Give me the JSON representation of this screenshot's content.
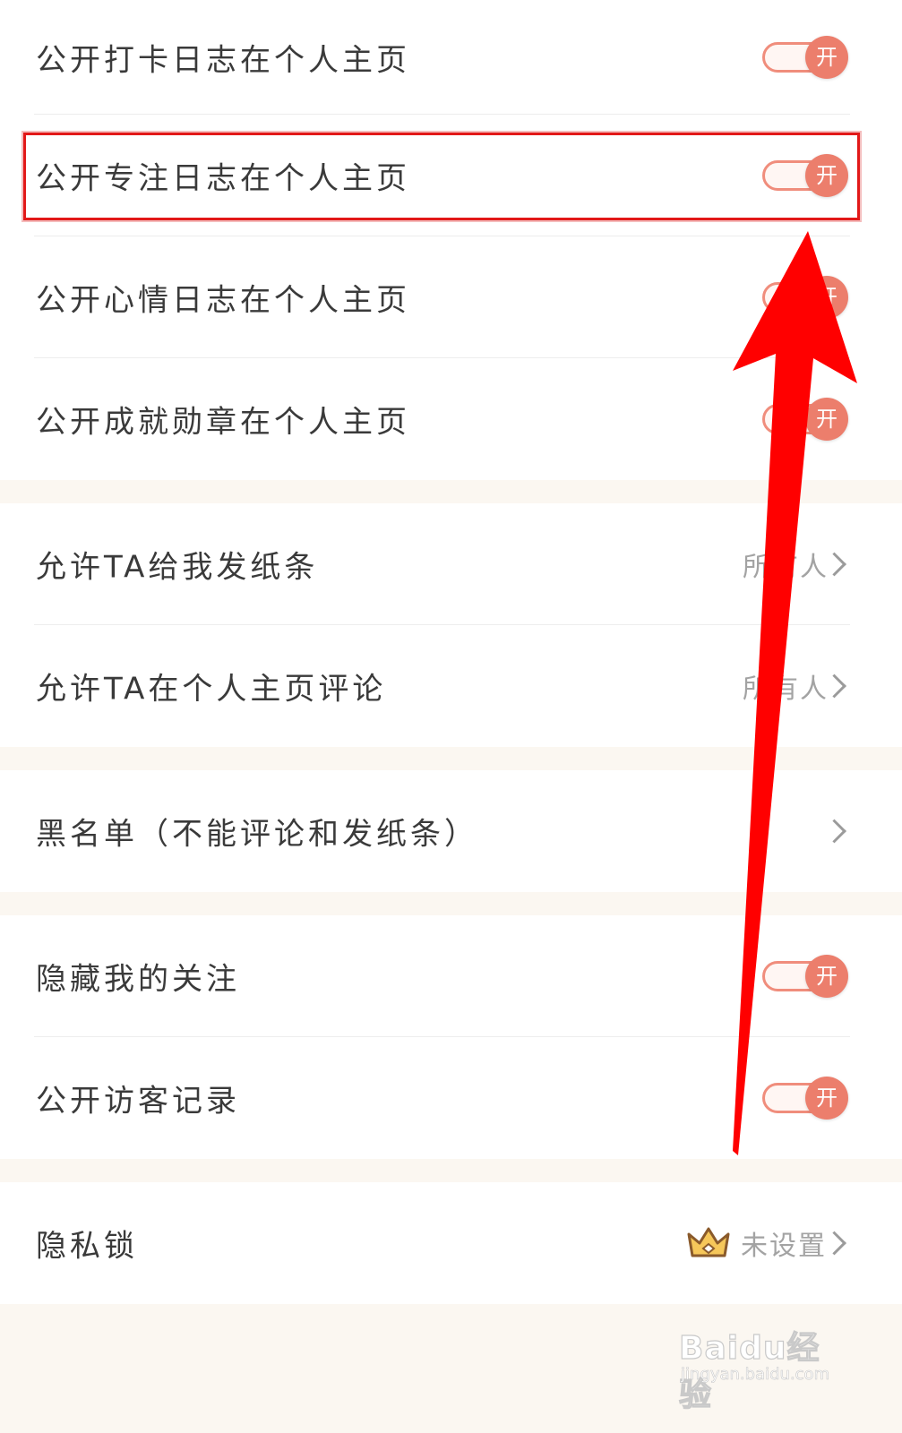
{
  "sections": [
    {
      "rows": [
        {
          "label": "公开打卡日志在个人主页",
          "toggle": "开",
          "on": true
        },
        {
          "label": "公开专注日志在个人主页",
          "toggle": "开",
          "on": true
        },
        {
          "label": "公开心情日志在个人主页",
          "toggle": "开",
          "on": true
        },
        {
          "label": "公开成就勋章在个人主页",
          "toggle": "开",
          "on": true
        }
      ]
    },
    {
      "rows": [
        {
          "label": "允许TA给我发纸条",
          "value": "所有人"
        },
        {
          "label": "允许TA在个人主页评论",
          "value": "所有人"
        }
      ]
    },
    {
      "rows": [
        {
          "label": "黑名单（不能评论和发纸条）"
        }
      ]
    },
    {
      "rows": [
        {
          "label": "隐藏我的关注",
          "toggle": "开",
          "on": true
        },
        {
          "label": "公开访客记录",
          "toggle": "开",
          "on": true
        }
      ]
    },
    {
      "rows": [
        {
          "label": "隐私锁",
          "value": "未设置",
          "icon": "crown-icon"
        }
      ]
    }
  ],
  "colors": {
    "accent": "#ec7e6c",
    "highlight": "#e21818",
    "arrow": "#ff0000",
    "background": "#fbf7f1"
  },
  "watermark": {
    "logo": "Baidu经验",
    "url": "jingyan.baidu.com"
  }
}
